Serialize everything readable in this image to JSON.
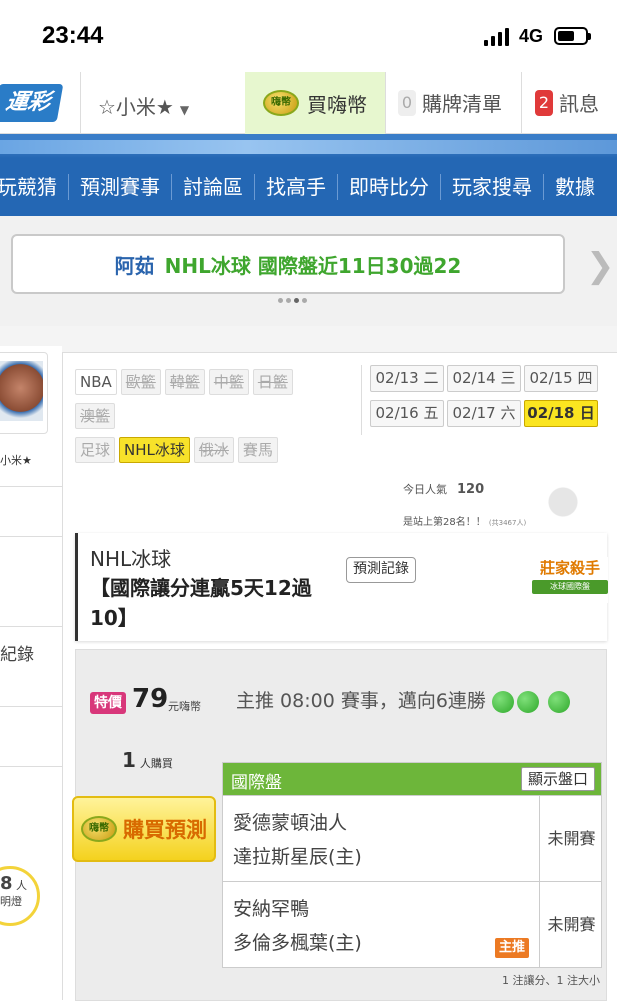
{
  "status": {
    "time": "23:44",
    "network": "4G"
  },
  "topnav": {
    "logo": "運彩",
    "user": "☆小米★",
    "buy_label": "買嗨幣",
    "coin_text": "嗨幣",
    "cart_count": "0",
    "cart_label": "購牌清單",
    "msg_count": "2",
    "msg_label": "訊息"
  },
  "mainnav": {
    "items": [
      "玩競猜",
      "預測賽事",
      "討論區",
      "找高手",
      "即時比分",
      "玩家搜尋",
      "數據"
    ]
  },
  "banner": {
    "name": "阿茹",
    "text": "NHL冰球 國際盤近11日30過22"
  },
  "sidebar": {
    "username": "小米★",
    "items": [
      "",
      "",
      "紀錄",
      "",
      ""
    ],
    "bulb_count": "8",
    "bulb_unit": "人",
    "bulb_sub": "明燈"
  },
  "categories": [
    {
      "label": "NBA",
      "state": "act"
    },
    {
      "label": "歐籃",
      "state": "dis"
    },
    {
      "label": "韓籃",
      "state": "dis"
    },
    {
      "label": "中籃",
      "state": "dis"
    },
    {
      "label": "日籃",
      "state": "dis"
    },
    {
      "label": "澳籃",
      "state": "dis"
    },
    {
      "label": "足球",
      "state": "off"
    },
    {
      "label": "NHL冰球",
      "state": "sel"
    },
    {
      "label": "俄冰",
      "state": "dis"
    },
    {
      "label": "賽馬",
      "state": "off"
    }
  ],
  "dates": [
    {
      "label": "02/13 二",
      "selected": false
    },
    {
      "label": "02/14 三",
      "selected": false
    },
    {
      "label": "02/15 四",
      "selected": false
    },
    {
      "label": "02/16 五",
      "selected": false
    },
    {
      "label": "02/17 六",
      "selected": false
    },
    {
      "label": "02/18 日",
      "selected": true
    }
  ],
  "popularity": {
    "label": "今日人氣",
    "value": "120"
  },
  "rank": {
    "text": "是站上第28名！！",
    "note": "(共3467人)"
  },
  "card": {
    "title": "NHL冰球",
    "subtitle": "【國際讓分連贏5天12過10】",
    "record_button": "預測記錄",
    "stamp_title": "莊家殺手",
    "stamp_sub": "冰球國際盤"
  },
  "offer": {
    "tag": "特價",
    "price": "79",
    "unit": "元嗨幣",
    "buyers": "1",
    "buyers_unit": "人購買",
    "buy_button": "購買預測"
  },
  "headline": "主推 08:00 賽事，邁向6連勝",
  "table": {
    "header": "國際盤",
    "show_button": "顯示盤口",
    "rows": [
      {
        "away": "愛德蒙頓油人",
        "home": "達拉斯星辰(主)",
        "status": "未開賽",
        "pick": ""
      },
      {
        "away": "安納罕鴨",
        "home": "多倫多楓葉(主)",
        "status": "未開賽",
        "pick": "主推"
      }
    ]
  },
  "footer": "1 注讓分、1 注大小"
}
